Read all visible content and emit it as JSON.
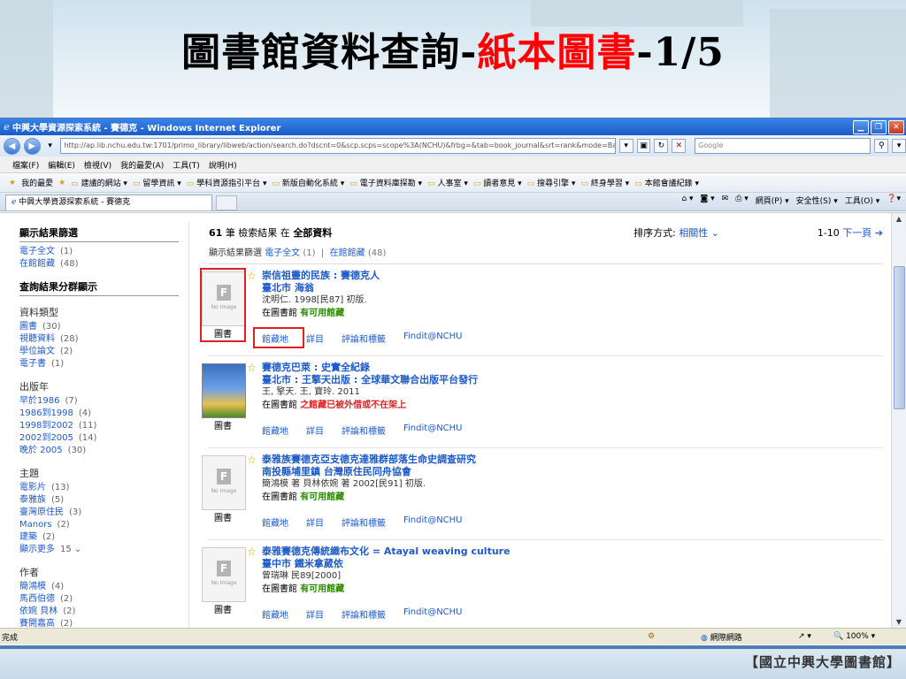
{
  "slide": {
    "title_black": "圖書館資料查詢-",
    "title_red": "紙本圖書",
    "title_tail": "-1/5",
    "footer": "【國立中興大學圖書館】"
  },
  "browser": {
    "window_title": "中興大學資源探索系統 - 賽德克 - Windows Internet Explorer",
    "url": "http://ap.lib.nchu.edu.tw:1701/primo_library/libweb/action/search.do?dscnt=0&scp.scps=scope%3A(NCHU)&frbg=&tab=book_journal&srt=rank&mode=Basic&du",
    "search_placeholder": "Google",
    "menu": [
      "檔案(F)",
      "編輯(E)",
      "檢視(V)",
      "我的最愛(A)",
      "工具(T)",
      "說明(H)"
    ],
    "favorites": [
      "我的最愛",
      "建議的網站 ▾",
      "留學資訊 ▾",
      "學科資源指引平台 ▾",
      "新版自動化系統 ▾",
      "電子資料庫探勘 ▾",
      "人事室 ▾",
      "讀者意見 ▾",
      "搜尋引擎 ▾",
      "終身學習 ▾",
      "本館會議紀錄 ▾"
    ],
    "tab_label": "中興大學資源探索系統 - 賽德克",
    "command_bar": [
      "網頁(P) ▾",
      "安全性(S) ▾",
      "工具(O) ▾"
    ],
    "status_done": "完成",
    "status_zone": "網際網路",
    "status_zoom": "100%"
  },
  "facets": {
    "filter_title": "顯示結果篩選",
    "filters": [
      {
        "label": "電子全文",
        "count": "(1)"
      },
      {
        "label": "在館館藏",
        "count": "(48)"
      }
    ],
    "group_title": "查詢結果分群顯示",
    "sections": [
      {
        "title": "資料類型",
        "items": [
          {
            "label": "圖書",
            "count": "(30)"
          },
          {
            "label": "視聽資料",
            "count": "(28)"
          },
          {
            "label": "學位論文",
            "count": "(2)"
          },
          {
            "label": "電子書",
            "count": "(1)"
          }
        ]
      },
      {
        "title": "出版年",
        "items": [
          {
            "label": "早於1986",
            "count": "(7)"
          },
          {
            "label": "1986到1998",
            "count": "(4)"
          },
          {
            "label": "1998到2002",
            "count": "(11)"
          },
          {
            "label": "2002到2005",
            "count": "(14)"
          },
          {
            "label": "晚於 2005",
            "count": "(30)"
          }
        ]
      },
      {
        "title": "主題",
        "items": [
          {
            "label": "電影片",
            "count": "(13)"
          },
          {
            "label": "泰雅族",
            "count": "(5)"
          },
          {
            "label": "臺灣原住民",
            "count": "(3)"
          },
          {
            "label": "Manors",
            "count": "(2)"
          },
          {
            "label": "建築",
            "count": "(2)"
          },
          {
            "label": "顯示更多",
            "count": "15 ⌄"
          }
        ]
      },
      {
        "title": "作者",
        "items": [
          {
            "label": "簡鴻模",
            "count": "(4)"
          },
          {
            "label": "馬西伯德",
            "count": "(2)"
          },
          {
            "label": "依婉 貝林",
            "count": "(2)"
          },
          {
            "label": "賽開嘉高",
            "count": "(2)"
          }
        ]
      }
    ]
  },
  "results": {
    "count": "61",
    "count_text": "筆 檢索結果 在",
    "scope": "全部資料",
    "sort_label": "排序方式:",
    "sort_value": "相關性 ⌄",
    "pager": "1-10",
    "next": "下一頁 ➔",
    "filter_label": "顯示結果篩選",
    "filter_items": [
      "電子全文",
      "(1)",
      "在館館藏",
      "(48)"
    ],
    "link_labels": [
      "館藏地",
      "詳目",
      "評論和標籤",
      "Findit@NCHU"
    ],
    "items": [
      {
        "title": "崇信祖靈的民族 : 賽德克人",
        "pub": "臺北市 海翁",
        "author": "沈明仁. 1998[民87] 初版.",
        "loc": "在圖書館",
        "status": "有可用館藏",
        "status_color": "green",
        "type": "圖書",
        "thumb": "noimage"
      },
      {
        "title": "賽德克巴萊 : 史實全紀錄",
        "pub": "臺北市 : 王擎天出版 : 全球華文聯合出版平台發行",
        "author": "王, 擎天. 王, 寶玲. 2011",
        "loc": "在圖書館",
        "status": "之館藏已被外借或不在架上",
        "status_color": "red",
        "type": "圖書",
        "thumb": "cover"
      },
      {
        "title": "泰雅族賽德克亞支德克達雅群部落生命史調查研究",
        "pub": "南投縣埔里鎮 台灣原住民同舟協會",
        "author": "簡鴻模 著 貝林依婉 著 2002[民91] 初版.",
        "loc": "在圖書館",
        "status": "有可用館藏",
        "status_color": "green",
        "type": "圖書",
        "thumb": "noimage"
      },
      {
        "title": "泰雅賽德克傳統織布文化 = Atayal weaving culture",
        "pub": "臺中市 鐵米拿葳依",
        "author": "曾瑞琳 民89[2000]",
        "loc": "在圖書館",
        "status": "有可用館藏",
        "status_color": "green",
        "type": "圖書",
        "thumb": "noimage"
      }
    ]
  }
}
